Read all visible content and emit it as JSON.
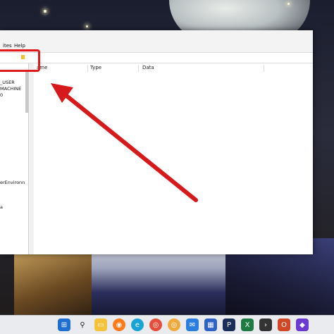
{
  "menu": {
    "favorites_partial": "ites",
    "help": "Help"
  },
  "tree": {
    "items": [
      "_USER",
      "MACHINE",
      "0",
      "erEnvironn",
      "a"
    ]
  },
  "list": {
    "columns": {
      "name_partial": "ame",
      "type": "Type",
      "data": "Data"
    }
  },
  "taskbar": {
    "icons": [
      "windows-start",
      "search",
      "file-explorer",
      "firefox",
      "edge",
      "chrome-1",
      "chrome-2",
      "mail",
      "store",
      "photoshop",
      "excel",
      "terminal",
      "office",
      "app"
    ]
  },
  "colors": {
    "highlight": "#e0191a",
    "arrow": "#d6191b"
  }
}
